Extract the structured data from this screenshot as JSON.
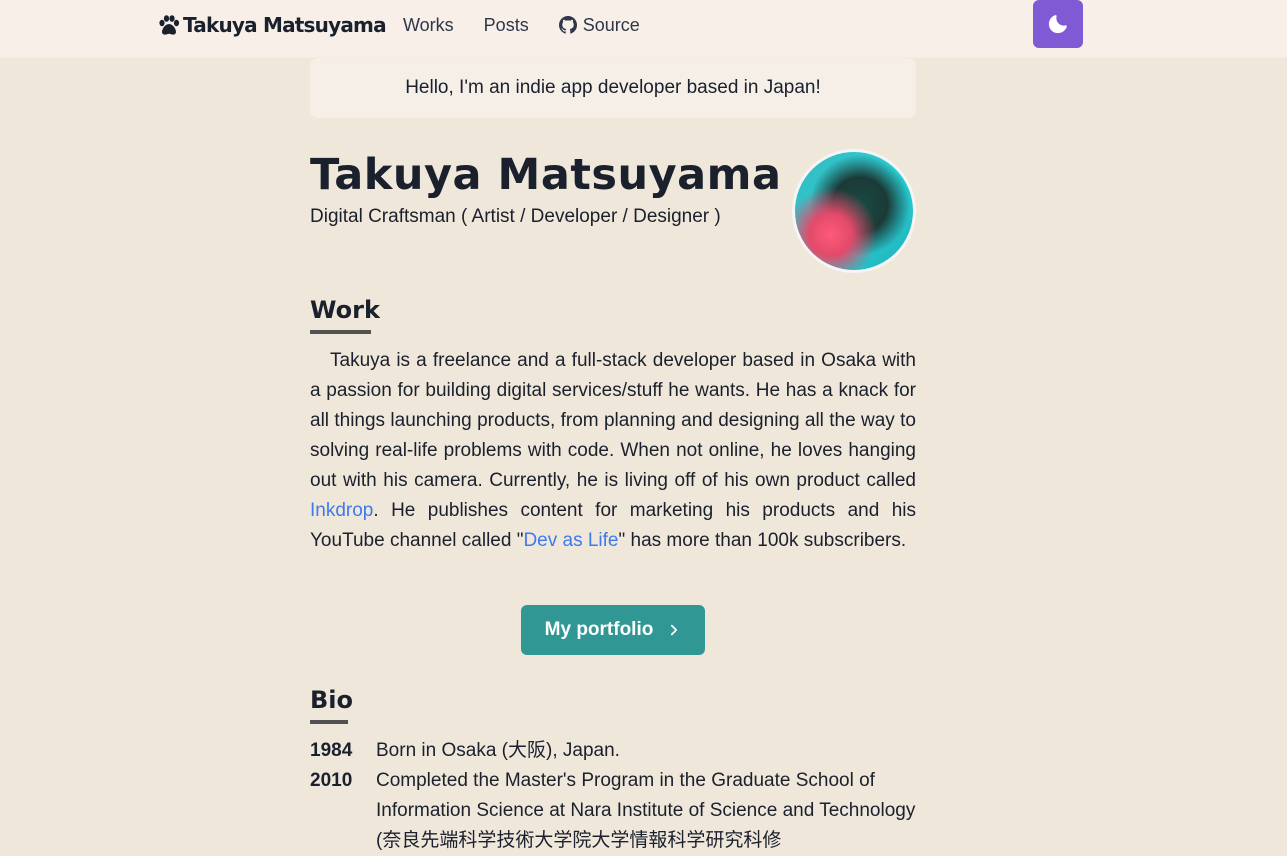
{
  "nav": {
    "logo_text": "Takuya Matsuyama",
    "links": [
      "Works",
      "Posts",
      "Source"
    ],
    "theme_toggle_icon": "moon-icon"
  },
  "intro": "Hello, I'm an indie app developer based in Japan!",
  "profile": {
    "name": "Takuya Matsuyama",
    "subtitle": "Digital Craftsman ( Artist / Developer / Designer )"
  },
  "work": {
    "title": "Work",
    "text_before_inkdrop": "Takuya is a freelance and a full-stack developer based in Osaka with a passion for building digital services/stuff he wants. He has a knack for all things launching products, from planning and designing all the way to solving real-life problems with code. When not online, he loves hanging out with his camera. Currently, he is living off of his own product called ",
    "inkdrop_link": "Inkdrop",
    "text_middle": ". He publishes content for marketing his products and his YouTube channel called \"",
    "devaslife_link": "Dev as Life",
    "text_after": "\" has more than 100k subscribers.",
    "button_label": "My portfolio"
  },
  "bio": {
    "title": "Bio",
    "entries": [
      {
        "year": "1984",
        "text": "Born in Osaka (大阪), Japan."
      },
      {
        "year": "2010",
        "text": "Completed the Master's Program in the Graduate School of Information Science at Nara Institute of Science and Technology (奈良先端科学技術大学院大学情報科学研究科修"
      }
    ]
  },
  "colors": {
    "background": "#f0e7db",
    "toggle": "#805ad5",
    "button": "#319795",
    "link": "#3d7aed"
  }
}
